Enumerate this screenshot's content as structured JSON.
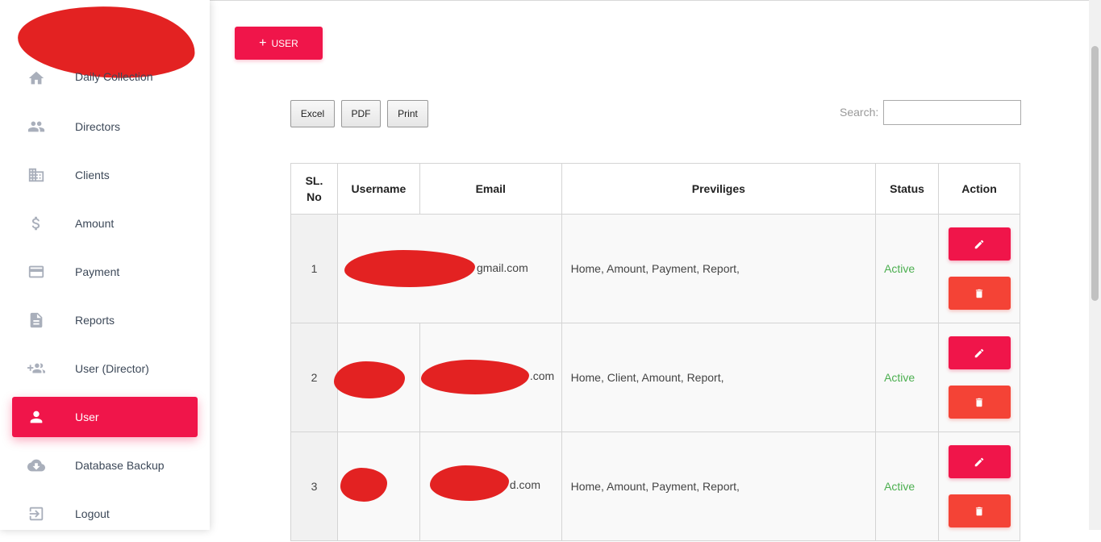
{
  "sidebar": {
    "items": [
      {
        "label": "Daily Collection",
        "icon": "home-icon"
      },
      {
        "label": "Directors",
        "icon": "people-icon"
      },
      {
        "label": "Clients",
        "icon": "building-icon"
      },
      {
        "label": "Amount",
        "icon": "dollar-icon"
      },
      {
        "label": "Payment",
        "icon": "credit-card-icon"
      },
      {
        "label": "Reports",
        "icon": "document-icon"
      },
      {
        "label": "User (Director)",
        "icon": "group-add-icon"
      },
      {
        "label": "User",
        "icon": "person-icon",
        "active": true
      },
      {
        "label": "Database Backup",
        "icon": "cloud-download-icon"
      },
      {
        "label": "Logout",
        "icon": "exit-icon"
      }
    ]
  },
  "main": {
    "add_user_label": "USER",
    "buttons": {
      "excel": "Excel",
      "pdf": "PDF",
      "print": "Print"
    },
    "search": {
      "label": "Search:",
      "value": ""
    },
    "table": {
      "headers": {
        "sl": "SL. No",
        "username": "Username",
        "email": "Email",
        "privileges": "Previliges",
        "status": "Status",
        "action": "Action"
      },
      "rows": [
        {
          "sl": "1",
          "email_visible": "gmail.com",
          "privileges": "Home, Amount, Payment, Report,",
          "status": "Active"
        },
        {
          "sl": "2",
          "email_visible": ".com",
          "privileges": "Home, Client, Amount, Report,",
          "status": "Active"
        },
        {
          "sl": "3",
          "email_visible": "d.com",
          "privileges": "Home, Amount, Payment, Report,",
          "status": "Active"
        }
      ]
    }
  },
  "colors": {
    "accent": "#f0154a",
    "danger": "#f44336",
    "active_status": "#4caf50",
    "redaction": "#e32222"
  }
}
